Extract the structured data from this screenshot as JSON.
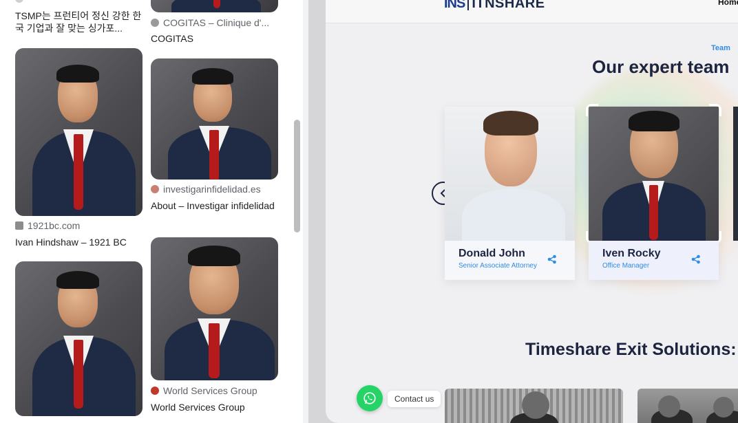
{
  "search_results": {
    "items": [
      {
        "source": "",
        "title": "TSMP는 프런티어 정신 강한 한국 기업과 잘 맞는 싱가포..."
      },
      {
        "source": "COGITAS – Clinique d'...",
        "title": "COGITAS"
      },
      {
        "source": "1921bc.com",
        "title": "Ivan Hindshaw – 1921 BC"
      },
      {
        "source": "investigarinfidelidad.es",
        "title": "About – Investigar infidelidad"
      },
      {
        "source": "World Services Group",
        "title": "World Services Group"
      }
    ]
  },
  "site": {
    "logo_mark": "INS",
    "logo_name": "ITNSHARE",
    "nav_home": "Home",
    "team_kicker": "Team",
    "team_title": "Our expert team",
    "members": [
      {
        "name": "Donald John",
        "role": "Senior Associate Attorney"
      },
      {
        "name": "Iven Rocky",
        "role": "Office Manager"
      }
    ],
    "solutions_title": "Timeshare Exit Solutions: Fa",
    "contact_label": "Contact us"
  },
  "colors": {
    "accent": "#2f8de4",
    "navy": "#1d2440",
    "whatsapp": "#25d366",
    "tie_red": "#b51b1b"
  }
}
